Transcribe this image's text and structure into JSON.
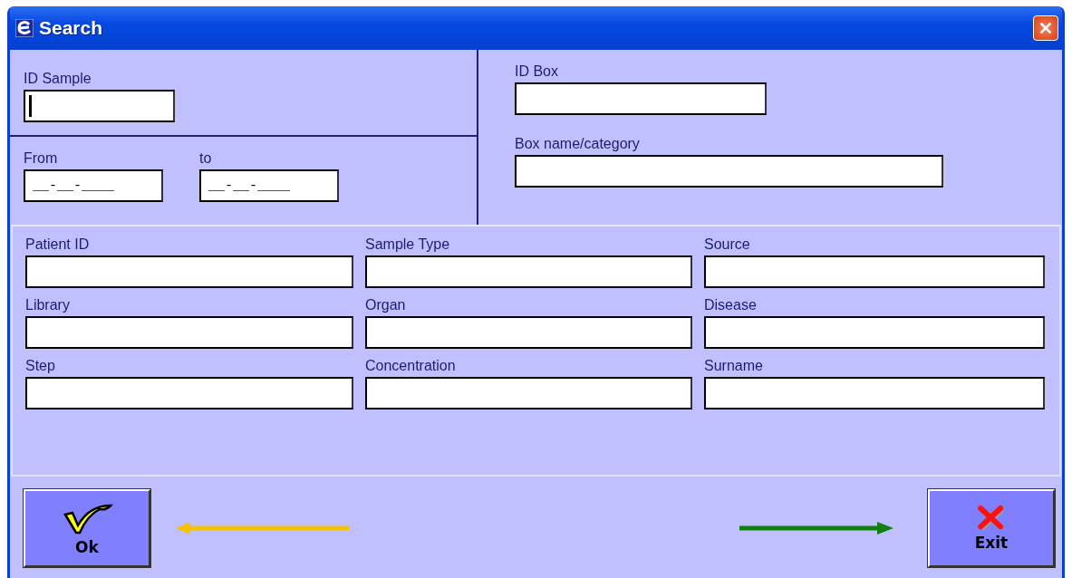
{
  "window": {
    "title": "Search"
  },
  "id_sample": {
    "label": "ID Sample",
    "focused": true
  },
  "date_range": [
    {
      "label": "From",
      "value": "__-__-____"
    },
    {
      "label": "to",
      "value": "__-__-____"
    }
  ],
  "box": [
    {
      "label": "ID Box"
    },
    {
      "label": "Box name/category"
    }
  ],
  "fields": [
    {
      "label": "Patient ID"
    },
    {
      "label": "Sample Type"
    },
    {
      "label": "Source"
    },
    {
      "label": "Library"
    },
    {
      "label": "Organ"
    },
    {
      "label": "Disease"
    },
    {
      "label": "Step"
    },
    {
      "label": "Concentration"
    },
    {
      "label": "Surname"
    }
  ],
  "buttons": [
    {
      "kind": "ok",
      "label": "Ok"
    },
    {
      "kind": "exit",
      "label": "Exit"
    }
  ]
}
